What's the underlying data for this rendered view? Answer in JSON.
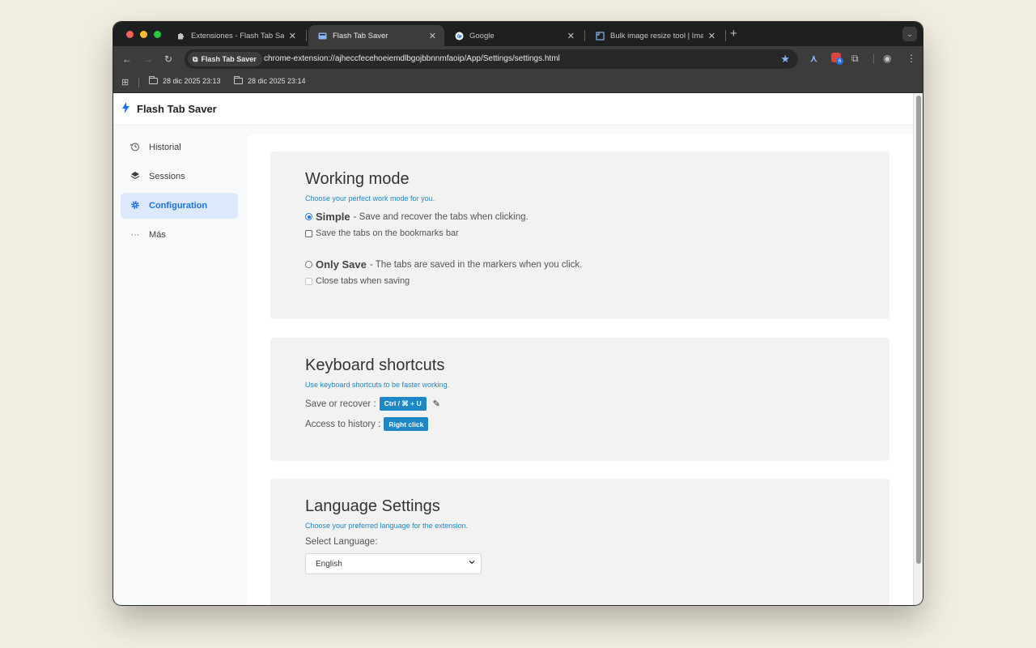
{
  "browser": {
    "tabs": [
      {
        "title": "Extensiones - Flash Tab Saver",
        "icon": "puzzle-icon"
      },
      {
        "title": "Flash Tab Saver",
        "icon": "flash-tab-saver-icon"
      },
      {
        "title": "Google",
        "icon": "google-icon"
      },
      {
        "title": "Bulk image resize tool | Image",
        "icon": "resize-icon"
      }
    ],
    "new_tab": "+",
    "address_chip": "Flash Tab Saver",
    "url": "chrome-extension://ajheccfecehoeiemdlbgojbbnnmfaoip/App/Settings/settings.html",
    "extension_badge": "6",
    "bookmarks": [
      "28 dic 2025 23:13",
      "28 dic 2025 23:14"
    ]
  },
  "app": {
    "brand": "Flash Tab Saver",
    "nav": [
      {
        "label": "Historial",
        "icon": "history-icon"
      },
      {
        "label": "Sessions",
        "icon": "layers-icon"
      },
      {
        "label": "Configuration",
        "icon": "gear-icon"
      },
      {
        "label": "Más",
        "icon": "more-icon"
      }
    ]
  },
  "working_mode": {
    "title": "Working mode",
    "subtitle": "Choose your perfect work mode for you.",
    "simple_label": "Simple",
    "simple_desc": "- Save and recover the tabs when clicking.",
    "simple_checkbox": "Save the tabs on the bookmarks bar",
    "only_save_label": "Only Save",
    "only_save_desc": "- The tabs are saved in the markers when you click.",
    "only_save_checkbox": "Close tabs when saving"
  },
  "shortcuts": {
    "title": "Keyboard shortcuts",
    "subtitle": "Use keyboard shortcuts to be faster working.",
    "save_label": "Save or recover :",
    "save_key": "Ctrl / ⌘ + U",
    "history_label": "Access to history :",
    "history_key": "Right click"
  },
  "language": {
    "title": "Language Settings",
    "subtitle": "Choose your preferred language for the extension.",
    "select_label": "Select Language:",
    "selected": "English"
  },
  "colors": {
    "accent": "#1a73e8",
    "link_blue": "#1e88c7",
    "card_bg": "#f2f2f2",
    "page_bg": "#f1ede0"
  }
}
